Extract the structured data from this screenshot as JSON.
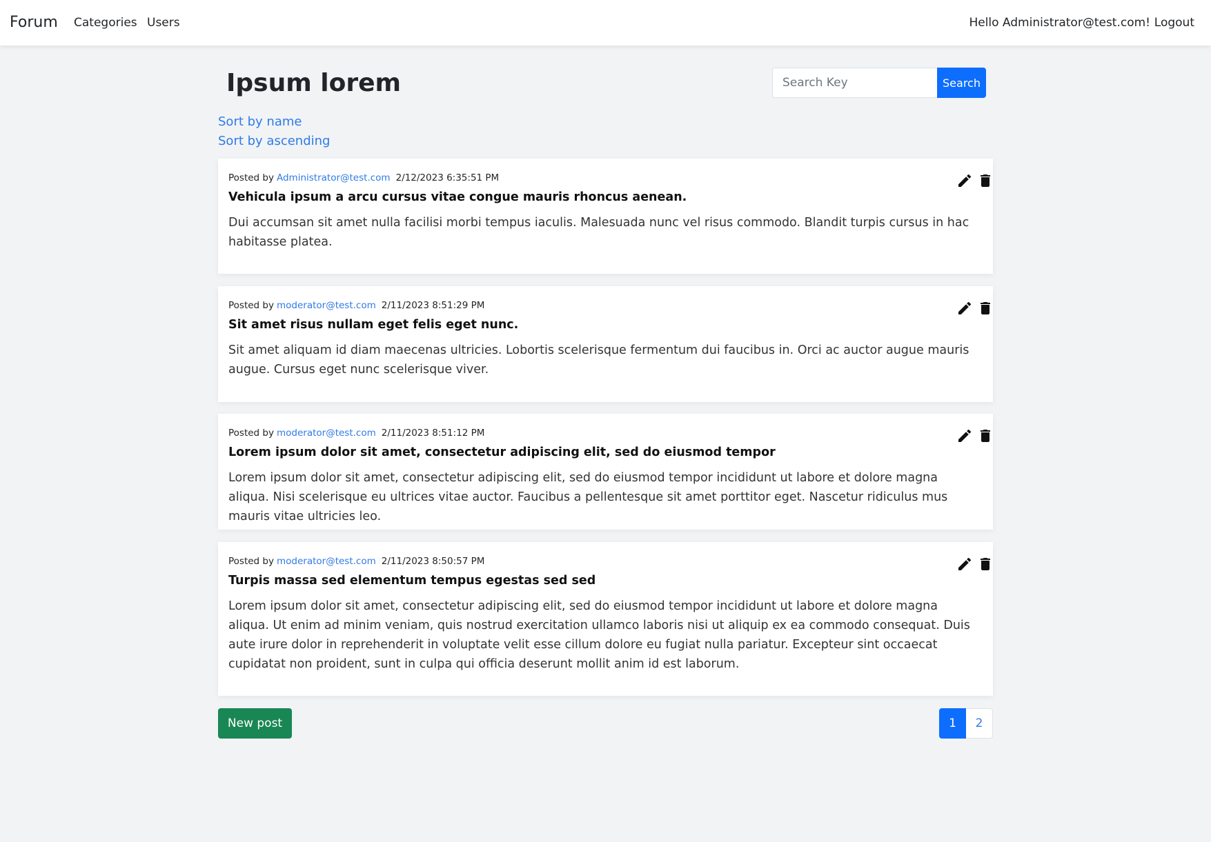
{
  "navbar": {
    "brand": "Forum",
    "links": [
      "Categories",
      "Users"
    ],
    "greeting": "Hello Administrator@test.com!",
    "logout": "Logout"
  },
  "page": {
    "title": "Ipsum lorem",
    "search": {
      "placeholder": "Search Key",
      "value": "",
      "button_label": "Search"
    },
    "sort_by_name": "Sort by name",
    "sort_by_ascending": "Sort by ascending"
  },
  "posts": [
    {
      "posted_by_label": "Posted by",
      "author": "Administrator@test.com",
      "date": "2/12/2023 6:35:51 PM",
      "title": "Vehicula ipsum a arcu cursus vitae congue mauris rhoncus aenean.",
      "body": "Dui accumsan sit amet nulla facilisi morbi tempus iaculis. Malesuada nunc vel risus commodo. Blandit turpis cursus in hac habitasse platea."
    },
    {
      "posted_by_label": "Posted by",
      "author": "moderator@test.com",
      "date": "2/11/2023 8:51:29 PM",
      "title": "Sit amet risus nullam eget felis eget nunc.",
      "body": "Sit amet aliquam id diam maecenas ultricies. Lobortis scelerisque fermentum dui faucibus in. Orci ac auctor augue mauris augue. Cursus eget nunc scelerisque viver."
    },
    {
      "posted_by_label": "Posted by",
      "author": "moderator@test.com",
      "date": "2/11/2023 8:51:12 PM",
      "title": "Lorem ipsum dolor sit amet, consectetur adipiscing elit, sed do eiusmod tempor",
      "body": "Lorem ipsum dolor sit amet, consectetur adipiscing elit, sed do eiusmod tempor incididunt ut labore et dolore magna aliqua. Nisi scelerisque eu ultrices vitae auctor. Faucibus a pellentesque sit amet porttitor eget. Nascetur ridiculus mus mauris vitae ultricies leo."
    },
    {
      "posted_by_label": "Posted by",
      "author": "moderator@test.com",
      "date": "2/11/2023 8:50:57 PM",
      "title": "Turpis massa sed elementum tempus egestas sed sed",
      "body": "Lorem ipsum dolor sit amet, consectetur adipiscing elit, sed do eiusmod tempor incididunt ut labore et dolore magna aliqua. Ut enim ad minim veniam, quis nostrud exercitation ullamco laboris nisi ut aliquip ex ea commodo consequat. Duis aute irure dolor in reprehenderit in voluptate velit esse cillum dolore eu fugiat nulla pariatur. Excepteur sint occaecat cupidatat non proident, sunt in culpa qui officia deserunt mollit anim id est laborum."
    }
  ],
  "icons": {
    "edit": "pencil-icon",
    "delete": "trash-icon"
  },
  "footer": {
    "new_post_label": "New post",
    "pages": [
      "1",
      "2"
    ],
    "active_page": "1"
  },
  "colors": {
    "background": "#f1f3f5",
    "primary": "#0d6efd",
    "link": "#2f7be5",
    "success": "#198754"
  }
}
